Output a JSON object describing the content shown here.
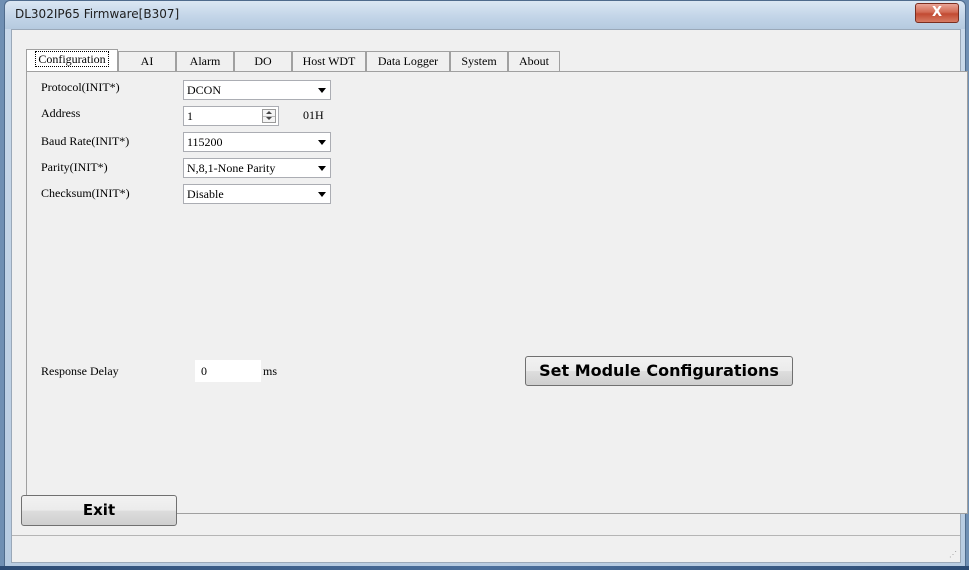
{
  "window": {
    "title": "DL302IP65 Firmware[B307]",
    "close_glyph": "X"
  },
  "tabs": [
    {
      "label": "Configuration",
      "active": true
    },
    {
      "label": "AI"
    },
    {
      "label": "Alarm"
    },
    {
      "label": "DO"
    },
    {
      "label": "Host WDT"
    },
    {
      "label": "Data Logger"
    },
    {
      "label": "System"
    },
    {
      "label": "About"
    }
  ],
  "config": {
    "protocol": {
      "label": "Protocol(INIT*)",
      "value": "DCON"
    },
    "address": {
      "label": "Address",
      "value": "1",
      "hex": "01H"
    },
    "baud_rate": {
      "label": "Baud Rate(INIT*)",
      "value": "115200"
    },
    "parity": {
      "label": "Parity(INIT*)",
      "value": "N,8,1-None Parity"
    },
    "checksum": {
      "label": "Checksum(INIT*)",
      "value": "Disable"
    },
    "response_delay": {
      "label": "Response Delay",
      "value": "0",
      "unit": "ms"
    },
    "set_button": "Set Module Configurations"
  },
  "footer": {
    "exit_button": "Exit",
    "status_text": ""
  },
  "icons": {
    "dropdown": "chevron-down-icon",
    "spinner": "spin-up-down-icon",
    "grip": "resize-grip-icon"
  }
}
